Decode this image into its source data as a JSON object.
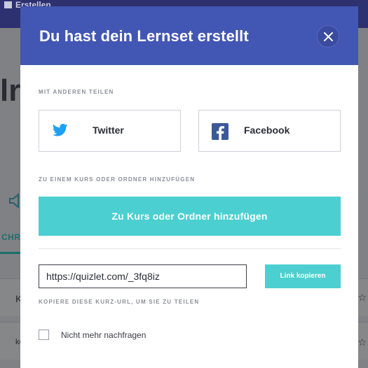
{
  "background": {
    "topbar_label": "Erstellen",
    "title_fragment": "lr",
    "tab_fragment": "CHRI",
    "row1_text": "K",
    "row2_text": "ke"
  },
  "modal": {
    "title": "Du hast dein Lernset erstellt",
    "share_section_label": "MIT ANDEREN TEILEN",
    "twitter_label": "Twitter",
    "facebook_label": "Facebook",
    "course_section_label": "ZU EINEM KURS ODER ORDNER HINZUFÜGEN",
    "add_button_label": "Zu Kurs oder Ordner hinzufügen",
    "url_value": "https://quizlet.com/_3fq8iz",
    "copy_button_label": "Link kopieren",
    "url_hint": "KOPIERE DIESE KURZ-URL, UM SIE ZU TEILEN",
    "checkbox_label": "Nicht mehr nachfragen"
  },
  "colors": {
    "header": "#4256b3",
    "accent": "#4ccfd0",
    "twitter": "#1da1f2",
    "facebook": "#3b5998"
  }
}
